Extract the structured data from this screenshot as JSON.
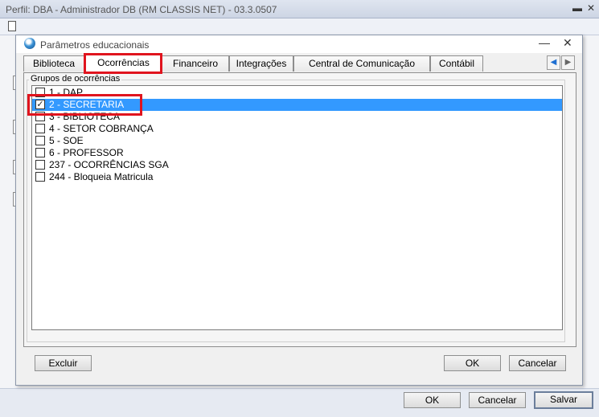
{
  "outer_window": {
    "title": "Perfil: DBA - Administrador DB (RM CLASSIS NET) - 03.3.0507",
    "footer": {
      "ok_label": "OK",
      "cancel_label": "Cancelar",
      "save_label": "Salvar"
    }
  },
  "dialog": {
    "title": "Parâmetros educacionais",
    "tabs": [
      {
        "label": "Biblioteca"
      },
      {
        "label": "Ocorrências"
      },
      {
        "label": "Financeiro"
      },
      {
        "label": "Integrações"
      },
      {
        "label": "Central de Comunicação"
      },
      {
        "label": "Contábil"
      }
    ],
    "active_tab": "Ocorrências",
    "group_label": "Grupos de ocorrências",
    "items": [
      {
        "label": "1 - DAP",
        "checked": false
      },
      {
        "label": "2 - SECRETARIA",
        "checked": true,
        "selected": true
      },
      {
        "label": "3 - BIBLIOTECA",
        "checked": false
      },
      {
        "label": "4 - SETOR COBRANÇA",
        "checked": false
      },
      {
        "label": "5 - SOE",
        "checked": false
      },
      {
        "label": "6 - PROFESSOR",
        "checked": false
      },
      {
        "label": "237 - OCORRÊNCIAS SGA",
        "checked": false
      },
      {
        "label": "244 - Bloqueia Matricula",
        "checked": false
      }
    ],
    "buttons": {
      "delete_label": "Excluir",
      "ok_label": "OK",
      "cancel_label": "Cancelar"
    }
  },
  "colors": {
    "selection": "#3399ff",
    "highlight": "#e0141e"
  }
}
